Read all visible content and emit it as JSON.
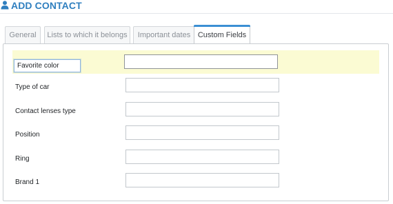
{
  "header": {
    "title": "ADD CONTACT",
    "icon": "user-icon",
    "accent_color": "#2f7fbf"
  },
  "tabs": [
    {
      "label": "General",
      "active": false
    },
    {
      "label": "Lists to which it belongs",
      "active": false
    },
    {
      "label": "Important dates",
      "active": false
    },
    {
      "label": "Custom Fields",
      "active": true
    }
  ],
  "custom_fields": [
    {
      "label": "Favorite color",
      "value": "",
      "editing": true
    },
    {
      "label": "Type of car",
      "value": ""
    },
    {
      "label": "Contact lenses type",
      "value": ""
    },
    {
      "label": "Position",
      "value": ""
    },
    {
      "label": "Ring",
      "value": ""
    },
    {
      "label": "Brand 1",
      "value": ""
    }
  ]
}
